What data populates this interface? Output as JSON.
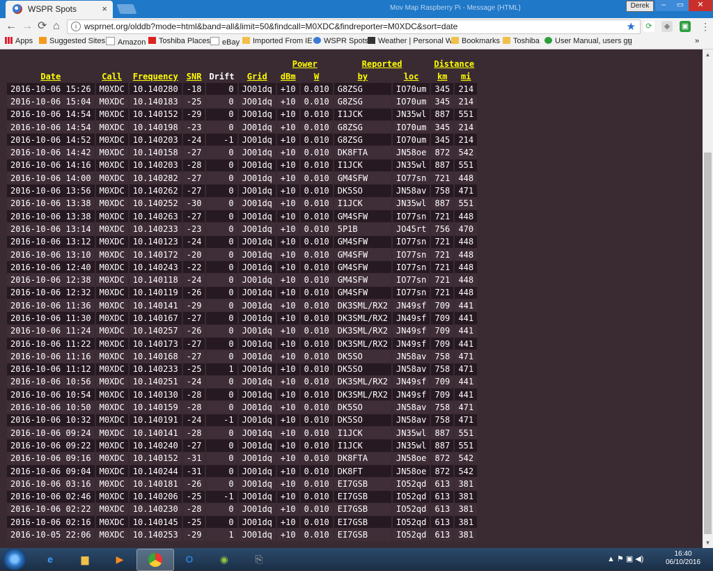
{
  "window": {
    "tab_title": "WSPR Spots",
    "tab_close": "×",
    "title_text": "Mov Map Raspberry Pi - Message (HTML)",
    "user_label": "Derek",
    "min": "–",
    "max": "▭",
    "close": "✕"
  },
  "toolbar": {
    "back": "←",
    "forward": "→",
    "reload": "⟳",
    "home": "⌂",
    "url": "wsprnet.org/olddb?mode=html&band=all&limit=50&findcall=M0XDC&findreporter=M0XDC&sort=date",
    "star": "★",
    "menu": "⋮"
  },
  "bookmarks": [
    {
      "label": "Apps",
      "icon": "apps-icon"
    },
    {
      "label": "Suggested Sites",
      "icon": "suggested-sites-icon"
    },
    {
      "label": "Amazon",
      "icon": "amazon-icon"
    },
    {
      "label": "Toshiba Places",
      "icon": "toshiba-icon"
    },
    {
      "label": "eBay",
      "icon": "ebay-icon"
    },
    {
      "label": "Imported From IE",
      "icon": "folder-icon"
    },
    {
      "label": "WSPR Spots",
      "icon": "wspr-icon"
    },
    {
      "label": "Weather | Personal W",
      "icon": "weather-icon"
    },
    {
      "label": "Bookmarks",
      "icon": "folder-icon"
    },
    {
      "label": "Toshiba",
      "icon": "folder-icon"
    },
    {
      "label": "User Manual, users gu",
      "icon": "manual-icon"
    },
    {
      "label": "»",
      "icon": "overflow-icon"
    }
  ],
  "table": {
    "group_headers": {
      "power": "Power",
      "reported": "Reported",
      "distance": "Distance"
    },
    "headers": [
      "Date",
      "Call",
      "Frequency",
      "SNR",
      "Drift",
      "Grid",
      "dBm",
      "W",
      "by",
      "loc",
      "km",
      "mi"
    ],
    "rows": [
      [
        "2016-10-06 15:26",
        "M0XDC",
        "10.140280",
        "-18",
        "0",
        "JO01dq",
        "+10",
        "0.010",
        "G8ZSG",
        "IO70um",
        "345",
        "214"
      ],
      [
        "2016-10-06 15:04",
        "M0XDC",
        "10.140183",
        "-25",
        "0",
        "JO01dq",
        "+10",
        "0.010",
        "G8ZSG",
        "IO70um",
        "345",
        "214"
      ],
      [
        "2016-10-06 14:54",
        "M0XDC",
        "10.140152",
        "-29",
        "0",
        "JO01dq",
        "+10",
        "0.010",
        "I1JCK",
        "JN35wl",
        "887",
        "551"
      ],
      [
        "2016-10-06 14:54",
        "M0XDC",
        "10.140198",
        "-23",
        "0",
        "JO01dq",
        "+10",
        "0.010",
        "G8ZSG",
        "IO70um",
        "345",
        "214"
      ],
      [
        "2016-10-06 14:52",
        "M0XDC",
        "10.140203",
        "-24",
        "-1",
        "JO01dq",
        "+10",
        "0.010",
        "G8ZSG",
        "IO70um",
        "345",
        "214"
      ],
      [
        "2016-10-06 14:42",
        "M0XDC",
        "10.140158",
        "-27",
        "0",
        "JO01dq",
        "+10",
        "0.010",
        "DK8FTA",
        "JN58oe",
        "872",
        "542"
      ],
      [
        "2016-10-06 14:16",
        "M0XDC",
        "10.140203",
        "-28",
        "0",
        "JO01dq",
        "+10",
        "0.010",
        "I1JCK",
        "JN35wl",
        "887",
        "551"
      ],
      [
        "2016-10-06 14:00",
        "M0XDC",
        "10.140282",
        "-27",
        "0",
        "JO01dq",
        "+10",
        "0.010",
        "GM4SFW",
        "IO77sn",
        "721",
        "448"
      ],
      [
        "2016-10-06 13:56",
        "M0XDC",
        "10.140262",
        "-27",
        "0",
        "JO01dq",
        "+10",
        "0.010",
        "DK5SO",
        "JN58av",
        "758",
        "471"
      ],
      [
        "2016-10-06 13:38",
        "M0XDC",
        "10.140252",
        "-30",
        "0",
        "JO01dq",
        "+10",
        "0.010",
        "I1JCK",
        "JN35wl",
        "887",
        "551"
      ],
      [
        "2016-10-06 13:38",
        "M0XDC",
        "10.140263",
        "-27",
        "0",
        "JO01dq",
        "+10",
        "0.010",
        "GM4SFW",
        "IO77sn",
        "721",
        "448"
      ],
      [
        "2016-10-06 13:14",
        "M0XDC",
        "10.140233",
        "-23",
        "0",
        "JO01dq",
        "+10",
        "0.010",
        "5P1B",
        "JO45rt",
        "756",
        "470"
      ],
      [
        "2016-10-06 13:12",
        "M0XDC",
        "10.140123",
        "-24",
        "0",
        "JO01dq",
        "+10",
        "0.010",
        "GM4SFW",
        "IO77sn",
        "721",
        "448"
      ],
      [
        "2016-10-06 13:10",
        "M0XDC",
        "10.140172",
        "-20",
        "0",
        "JO01dq",
        "+10",
        "0.010",
        "GM4SFW",
        "IO77sn",
        "721",
        "448"
      ],
      [
        "2016-10-06 12:40",
        "M0XDC",
        "10.140243",
        "-22",
        "0",
        "JO01dq",
        "+10",
        "0.010",
        "GM4SFW",
        "IO77sn",
        "721",
        "448"
      ],
      [
        "2016-10-06 12:38",
        "M0XDC",
        "10.140118",
        "-24",
        "0",
        "JO01dq",
        "+10",
        "0.010",
        "GM4SFW",
        "IO77sn",
        "721",
        "448"
      ],
      [
        "2016-10-06 12:32",
        "M0XDC",
        "10.140119",
        "-26",
        "0",
        "JO01dq",
        "+10",
        "0.010",
        "GM4SFW",
        "IO77sn",
        "721",
        "448"
      ],
      [
        "2016-10-06 11:36",
        "M0XDC",
        "10.140141",
        "-29",
        "0",
        "JO01dq",
        "+10",
        "0.010",
        "DK3SML/RX2",
        "JN49sf",
        "709",
        "441"
      ],
      [
        "2016-10-06 11:30",
        "M0XDC",
        "10.140167",
        "-27",
        "0",
        "JO01dq",
        "+10",
        "0.010",
        "DK3SML/RX2",
        "JN49sf",
        "709",
        "441"
      ],
      [
        "2016-10-06 11:24",
        "M0XDC",
        "10.140257",
        "-26",
        "0",
        "JO01dq",
        "+10",
        "0.010",
        "DK3SML/RX2",
        "JN49sf",
        "709",
        "441"
      ],
      [
        "2016-10-06 11:22",
        "M0XDC",
        "10.140173",
        "-27",
        "0",
        "JO01dq",
        "+10",
        "0.010",
        "DK3SML/RX2",
        "JN49sf",
        "709",
        "441"
      ],
      [
        "2016-10-06 11:16",
        "M0XDC",
        "10.140168",
        "-27",
        "0",
        "JO01dq",
        "+10",
        "0.010",
        "DK5SO",
        "JN58av",
        "758",
        "471"
      ],
      [
        "2016-10-06 11:12",
        "M0XDC",
        "10.140233",
        "-25",
        "1",
        "JO01dq",
        "+10",
        "0.010",
        "DK5SO",
        "JN58av",
        "758",
        "471"
      ],
      [
        "2016-10-06 10:56",
        "M0XDC",
        "10.140251",
        "-24",
        "0",
        "JO01dq",
        "+10",
        "0.010",
        "DK3SML/RX2",
        "JN49sf",
        "709",
        "441"
      ],
      [
        "2016-10-06 10:54",
        "M0XDC",
        "10.140130",
        "-28",
        "0",
        "JO01dq",
        "+10",
        "0.010",
        "DK3SML/RX2",
        "JN49sf",
        "709",
        "441"
      ],
      [
        "2016-10-06 10:50",
        "M0XDC",
        "10.140159",
        "-28",
        "0",
        "JO01dq",
        "+10",
        "0.010",
        "DK5SO",
        "JN58av",
        "758",
        "471"
      ],
      [
        "2016-10-06 10:32",
        "M0XDC",
        "10.140191",
        "-24",
        "-1",
        "JO01dq",
        "+10",
        "0.010",
        "DK5SO",
        "JN58av",
        "758",
        "471"
      ],
      [
        "2016-10-06 09:24",
        "M0XDC",
        "10.140141",
        "-28",
        "0",
        "JO01dq",
        "+10",
        "0.010",
        "I1JCK",
        "JN35wl",
        "887",
        "551"
      ],
      [
        "2016-10-06 09:22",
        "M0XDC",
        "10.140240",
        "-27",
        "0",
        "JO01dq",
        "+10",
        "0.010",
        "I1JCK",
        "JN35wl",
        "887",
        "551"
      ],
      [
        "2016-10-06 09:16",
        "M0XDC",
        "10.140152",
        "-31",
        "0",
        "JO01dq",
        "+10",
        "0.010",
        "DK8FTA",
        "JN58oe",
        "872",
        "542"
      ],
      [
        "2016-10-06 09:04",
        "M0XDC",
        "10.140244",
        "-31",
        "0",
        "JO01dq",
        "+10",
        "0.010",
        "DK8FT",
        "JN58oe",
        "872",
        "542"
      ],
      [
        "2016-10-06 03:16",
        "M0XDC",
        "10.140181",
        "-26",
        "0",
        "JO01dq",
        "+10",
        "0.010",
        "EI7GSB",
        "IO52qd",
        "613",
        "381"
      ],
      [
        "2016-10-06 02:46",
        "M0XDC",
        "10.140206",
        "-25",
        "-1",
        "JO01dq",
        "+10",
        "0.010",
        "EI7GSB",
        "IO52qd",
        "613",
        "381"
      ],
      [
        "2016-10-06 02:22",
        "M0XDC",
        "10.140230",
        "-28",
        "0",
        "JO01dq",
        "+10",
        "0.010",
        "EI7GSB",
        "IO52qd",
        "613",
        "381"
      ],
      [
        "2016-10-06 02:16",
        "M0XDC",
        "10.140145",
        "-25",
        "0",
        "JO01dq",
        "+10",
        "0.010",
        "EI7GSB",
        "IO52qd",
        "613",
        "381"
      ],
      [
        "2016-10-05 22:06",
        "M0XDC",
        "10.140253",
        "-29",
        "1",
        "JO01dq",
        "+10",
        "0.010",
        "EI7GSB",
        "IO52qd",
        "613",
        "381"
      ]
    ]
  },
  "taskbar": {
    "clock_time": "16:40",
    "clock_date": "06/10/2016",
    "tray_icons": "▲ ⚑ ▣ ◀)"
  },
  "colors": {
    "background": "#3a2b33",
    "row_odd": "#271922",
    "row_even": "#3f2d37",
    "header_link": "#ffff00"
  }
}
